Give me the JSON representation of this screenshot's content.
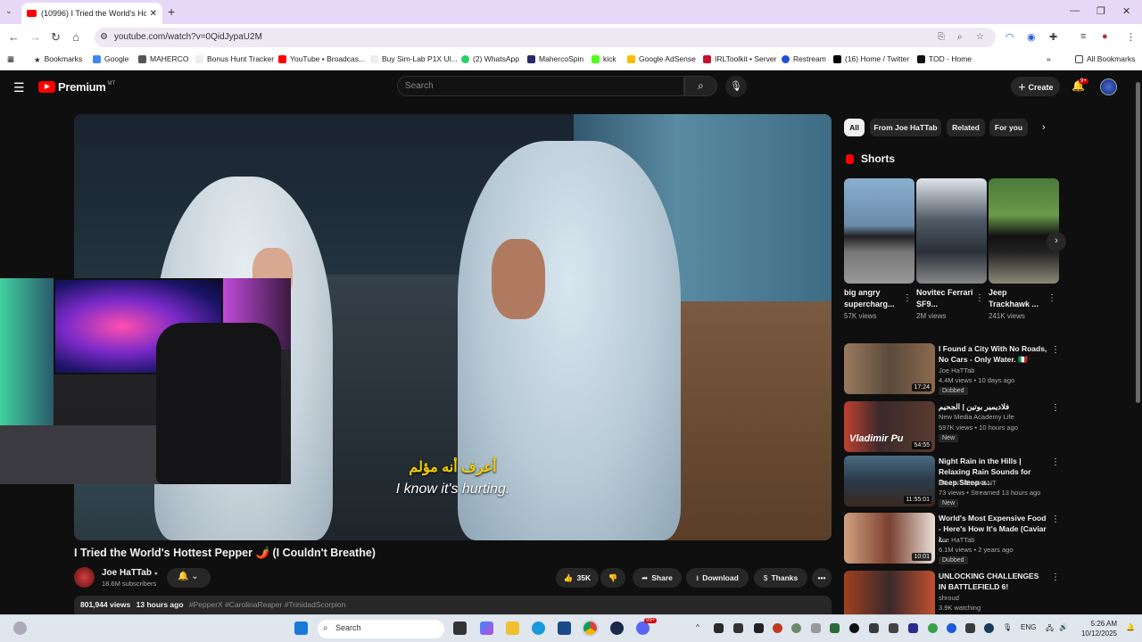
{
  "browser": {
    "tab_title": "(10996) I Tried the World's Hott",
    "tab_close": "✕",
    "new_tab": "+",
    "url": "youtube.com/watch?v=0QidJypaU2M",
    "window": {
      "minimize": "—",
      "maximize": "❐",
      "close": "✕"
    },
    "bookmarks": [
      {
        "label": "Bookmarks",
        "color": "#333333"
      },
      {
        "label": "Google",
        "color": "#4285f4"
      },
      {
        "label": "MAHERCO",
        "color": "#555555"
      },
      {
        "label": "Bonus Hunt Tracker",
        "color": "#ffffff"
      },
      {
        "label": "YouTube • Broadcas...",
        "color": "#ff0000"
      },
      {
        "label": "Buy Sim-Lab P1X Ul...",
        "color": "#ffffff"
      },
      {
        "label": "(2) WhatsApp",
        "color": "#25d366"
      },
      {
        "label": "MahercoSpin",
        "color": "#2a2a6a"
      },
      {
        "label": "kick",
        "color": "#53fc18"
      },
      {
        "label": "Google AdSense",
        "color": "#fbbc04"
      },
      {
        "label": "IRLToolkit • Server",
        "color": "#c8102e"
      },
      {
        "label": "Restream",
        "color": "#1e4fd8"
      },
      {
        "label": "(16) Home / Twitter",
        "color": "#000000"
      },
      {
        "label": "TOD - Home",
        "color": "#111111"
      }
    ],
    "all_bookmarks": "All Bookmarks"
  },
  "youtube": {
    "logo": "Premium",
    "logo_region": "MT",
    "search_placeholder": "Search",
    "create_label": "Create",
    "notif_badge": "9+",
    "subtitle_arabic": "أعرف أنه مؤلم",
    "subtitle_english": "I know it's hurting.",
    "video_title": "I Tried the World's Hottest Pepper 🌶️ (I Couldn't Breathe)",
    "channel": {
      "name": "Joe HaTTab",
      "verified": "●",
      "subscribers": "18.6M subscribers"
    },
    "actions": {
      "likes": "35K",
      "share": "Share",
      "download": "Download",
      "thanks": "Thanks",
      "more": "•••"
    },
    "description": {
      "views": "801,944 views",
      "time": "13 hours ago",
      "tags": "#PepperX #CarolinaReaper #TrinidadScorpion"
    },
    "chips": [
      "All",
      "From Joe HaTTab",
      "Related",
      "For you"
    ],
    "shorts_heading": "Shorts",
    "shorts": [
      {
        "title": "big angry supercharg...",
        "views": "57K views",
        "thumb_color": "#6a8aa8"
      },
      {
        "title": "Novitec Ferrari SF9...",
        "views": "2M views",
        "thumb_color": "#505a66"
      },
      {
        "title": "Jeep Trackhawk ...",
        "views": "241K views",
        "thumb_color": "#4a7a3a"
      }
    ],
    "recommendations": [
      {
        "title": "I Found a City With No Roads, No Cars - Only Water. 🇮🇹",
        "channel": "Joe HaTTab",
        "meta": "4.4M views • 10 days ago",
        "tag": "Dubbed",
        "duration": "17:24",
        "thumb_color": "#8a6a50"
      },
      {
        "title": "فلاديمير بوتين | الجحيم",
        "channel": "New Media Academy Life",
        "meta": "597K views • 10 hours ago",
        "tag": "New",
        "duration": "54:55",
        "thumb_color": "#3a2a2a",
        "overlay_text": "Vladimir Pu"
      },
      {
        "title": "Night Rain in the Hills | Relaxing Rain Sounds for Deep Sleep a...",
        "channel": "BRAIN RELAXANT",
        "meta": "73 views • Streamed 13 hours ago",
        "tag": "New",
        "duration": "11:55:01",
        "thumb_color": "#2a3a48"
      },
      {
        "title": "World's Most Expensive Food - Here's How It's Made (Caviar i...",
        "channel": "Joe HaTTab",
        "meta": "6.1M views • 2 years ago",
        "tag": "Dubbed",
        "duration": "10:01",
        "thumb_color": "#7a4030"
      },
      {
        "title": "UNLOCKING CHALLENGES IN BATTLEFIELD 6!",
        "channel": "shroud",
        "meta": "3.9K watching",
        "tag": "",
        "duration": "",
        "thumb_color": "#a04020"
      }
    ]
  },
  "taskbar": {
    "search_placeholder": "Search",
    "lang": "ENG",
    "time": "5:26 AM",
    "date": "10/12/2025",
    "chat_badge": "99+"
  }
}
